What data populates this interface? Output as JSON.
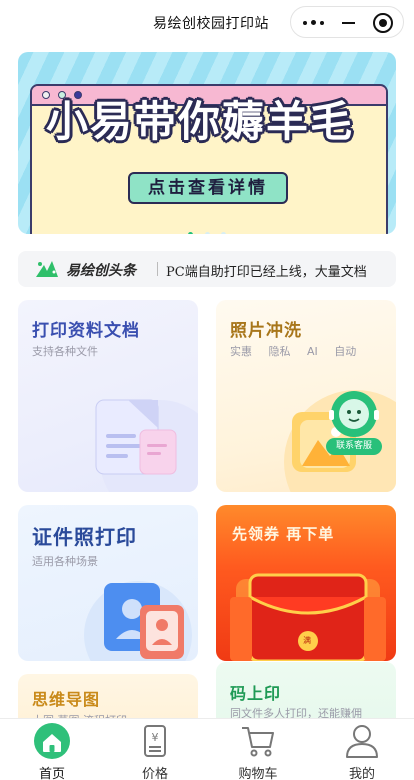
{
  "topbar": {
    "title": "易绘创校园打印站"
  },
  "banner": {
    "headline": "小易带你薅羊毛",
    "cta": "点击查看详情",
    "slide_count": 3,
    "active_slide": 1
  },
  "ticker": {
    "brand": "易绘创头条",
    "text": "PC端自助打印已经上线，大量文档"
  },
  "cards": {
    "docs": {
      "title": "打印资料文档",
      "subtitle": "支持各种文件",
      "color": "#3a4fb0"
    },
    "photo": {
      "title": "照片冲洗",
      "tags": [
        "实惠",
        "隐私",
        "AI",
        "自动"
      ],
      "color": "#a8761a",
      "service_label": "联系客服"
    },
    "idphoto": {
      "title": "证件照打印",
      "subtitle": "适用各种场景",
      "color": "#2a4a9a"
    },
    "coupon": {
      "title": "先领券 再下单",
      "badge": "满"
    },
    "mindmap": {
      "title": "思维导图",
      "subtitle": "大图 草图 流程打印",
      "color": "#c98a1a"
    },
    "scan": {
      "title": "码上印",
      "subtitle": "同文件多人打印，还能赚佣",
      "color": "#1f9a55"
    }
  },
  "tabbar": {
    "items": [
      {
        "label": "首页",
        "icon": "home-icon",
        "active": true
      },
      {
        "label": "价格",
        "icon": "price-icon",
        "active": false
      },
      {
        "label": "购物车",
        "icon": "cart-icon",
        "active": false
      },
      {
        "label": "我的",
        "icon": "profile-icon",
        "active": false
      }
    ],
    "accent": "#2fc07a"
  }
}
